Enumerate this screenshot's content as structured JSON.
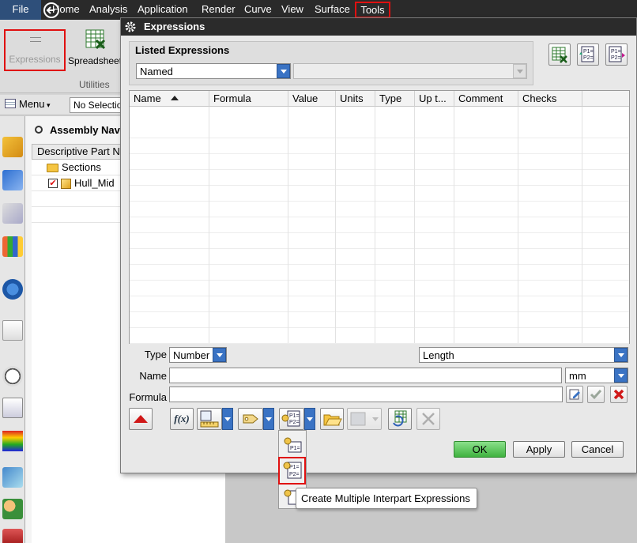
{
  "menubar": {
    "file": "File",
    "items": [
      "Home",
      "Analysis",
      "Application",
      "Render",
      "Curve",
      "View",
      "Surface"
    ],
    "tools": "Tools"
  },
  "ribbon": {
    "expressions_label": "Expressions",
    "spreadsheet_label": "Spreadsheet",
    "group_label": "Utilities"
  },
  "toolbar": {
    "menu_label": "Menu",
    "selection_filter": "No Selection Filter"
  },
  "navigator": {
    "title": "Assembly Navigator",
    "column_header": "Descriptive Part Name",
    "nodes": [
      {
        "label": "Sections"
      },
      {
        "label": "Hull_Mid"
      }
    ]
  },
  "dialog": {
    "title": "Expressions",
    "listed_label": "Listed Expressions",
    "listed_value": "Named",
    "columns": [
      "Name",
      "Formula",
      "Value",
      "Units",
      "Type",
      "Up t...",
      "Comment",
      "Checks"
    ],
    "type_label": "Type",
    "type_value": "Number",
    "dimension_value": "Length",
    "name_label": "Name",
    "name_value": "",
    "units_value": "mm",
    "formula_label": "Formula",
    "formula_value": "",
    "fx_label": "f(x)",
    "ok": "OK",
    "apply": "Apply",
    "cancel": "Cancel"
  },
  "tooltip": "Create Multiple Interpart Expressions",
  "colors": {
    "highlight": "#e01010",
    "ok_button": "#5fc85f",
    "menubar": "#2a2a2a",
    "dropdown_blue": "#3a73c4"
  }
}
